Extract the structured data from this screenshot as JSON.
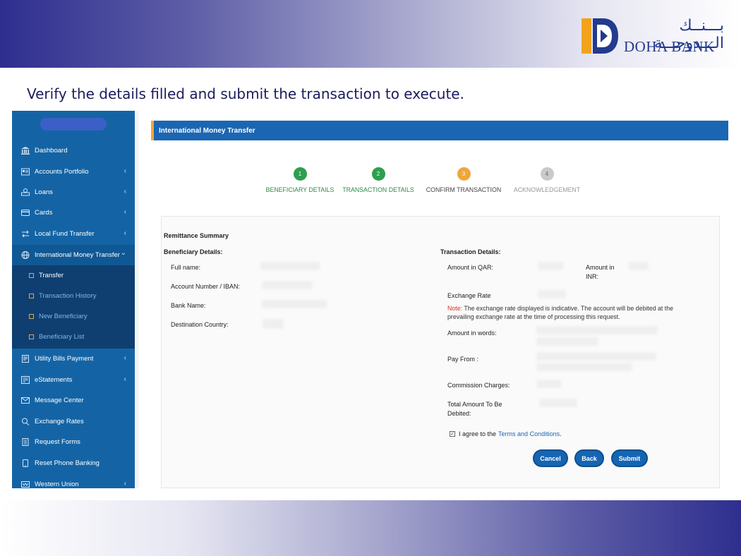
{
  "slide": {
    "instruction": "Verify the details filled and submit the transaction to execute.",
    "logo_arabic": "بـــنــك الـــدوحـــة",
    "logo_english": "DOHA BANK",
    "colors": {
      "band_dark": "#2e2e8f",
      "logo_blue": "#233a8e",
      "logo_gold": "#f2a21b"
    }
  },
  "sidebar": {
    "items": [
      {
        "label": "Dashboard",
        "icon": "bank-icon"
      },
      {
        "label": "Accounts Portfolio",
        "icon": "id-card-icon",
        "has_chevron": true
      },
      {
        "label": "Loans",
        "icon": "money-stack-icon",
        "has_chevron": true
      },
      {
        "label": "Cards",
        "icon": "credit-card-icon",
        "has_chevron": true
      },
      {
        "label": "Local Fund Transfer",
        "icon": "transfer-icon",
        "has_chevron": true
      },
      {
        "label": "International Money Transfer",
        "icon": "globe-icon",
        "has_chevron": true,
        "expanded": true
      },
      {
        "label": "Utility Bills Payment",
        "icon": "bill-icon",
        "has_chevron": true
      },
      {
        "label": "eStatements",
        "icon": "statement-icon",
        "has_chevron": true
      },
      {
        "label": "Message Center",
        "icon": "envelope-icon"
      },
      {
        "label": "Exchange Rates",
        "icon": "exchange-icon"
      },
      {
        "label": "Request Forms",
        "icon": "form-icon"
      },
      {
        "label": "Reset Phone Banking",
        "icon": "phone-icon"
      },
      {
        "label": "Western Union",
        "icon": "western-union-icon",
        "has_chevron": true
      }
    ],
    "sub_items": [
      {
        "label": "Transfer",
        "active": true
      },
      {
        "label": "Transaction History"
      },
      {
        "label": "New Beneficiary"
      },
      {
        "label": "Beneficiary List"
      }
    ],
    "chevron_left": "‹",
    "chevron_down": "⌄"
  },
  "main": {
    "title": "International Money Transfer",
    "steps": [
      {
        "number": "1",
        "label": "BENEFICIARY DETAILS",
        "state": "done",
        "color": "#2e9e4f"
      },
      {
        "number": "2",
        "label": "TRANSACTION DETAILS",
        "state": "done",
        "color": "#2e9e4f"
      },
      {
        "number": "3",
        "label": "CONFIRM TRANSACTION",
        "state": "current",
        "color": "#f0a63a"
      },
      {
        "number": "4",
        "label": "ACKNOWLEDGEMENT",
        "state": "pending",
        "color": "#bdbdbd"
      }
    ],
    "summary_title": "Remittance Summary",
    "beneficiary": {
      "heading": "Beneficiary Details:",
      "full_name_label": "Full name:",
      "account_label": "Account Number / IBAN:",
      "bank_label": "Bank Name:",
      "country_label": "Destination Country:"
    },
    "transaction": {
      "heading": "Transaction Details:",
      "amount_qar_label": "Amount in QAR:",
      "amount_inr_label_1": "Amount in",
      "amount_inr_label_2": "INR:",
      "exchange_rate_label": "Exchange Rate",
      "note_prefix": "Note:",
      "note_text": " The exchange rate displayed is indicative. The account will be debited at the prevailing exchange rate at the time of processing this request.",
      "amount_words_label": "Amount in words:",
      "pay_from_label": "Pay From :",
      "commission_label": "Commission Charges:",
      "total_label_1": "Total Amount To Be",
      "total_label_2": "Debited:"
    },
    "agree_text": "I agree to the",
    "agree_link": "Terms and Conditions",
    "agree_period": ".",
    "agree_checked": true,
    "buttons": {
      "cancel": "Cancel",
      "back": "Back",
      "submit": "Submit"
    }
  }
}
